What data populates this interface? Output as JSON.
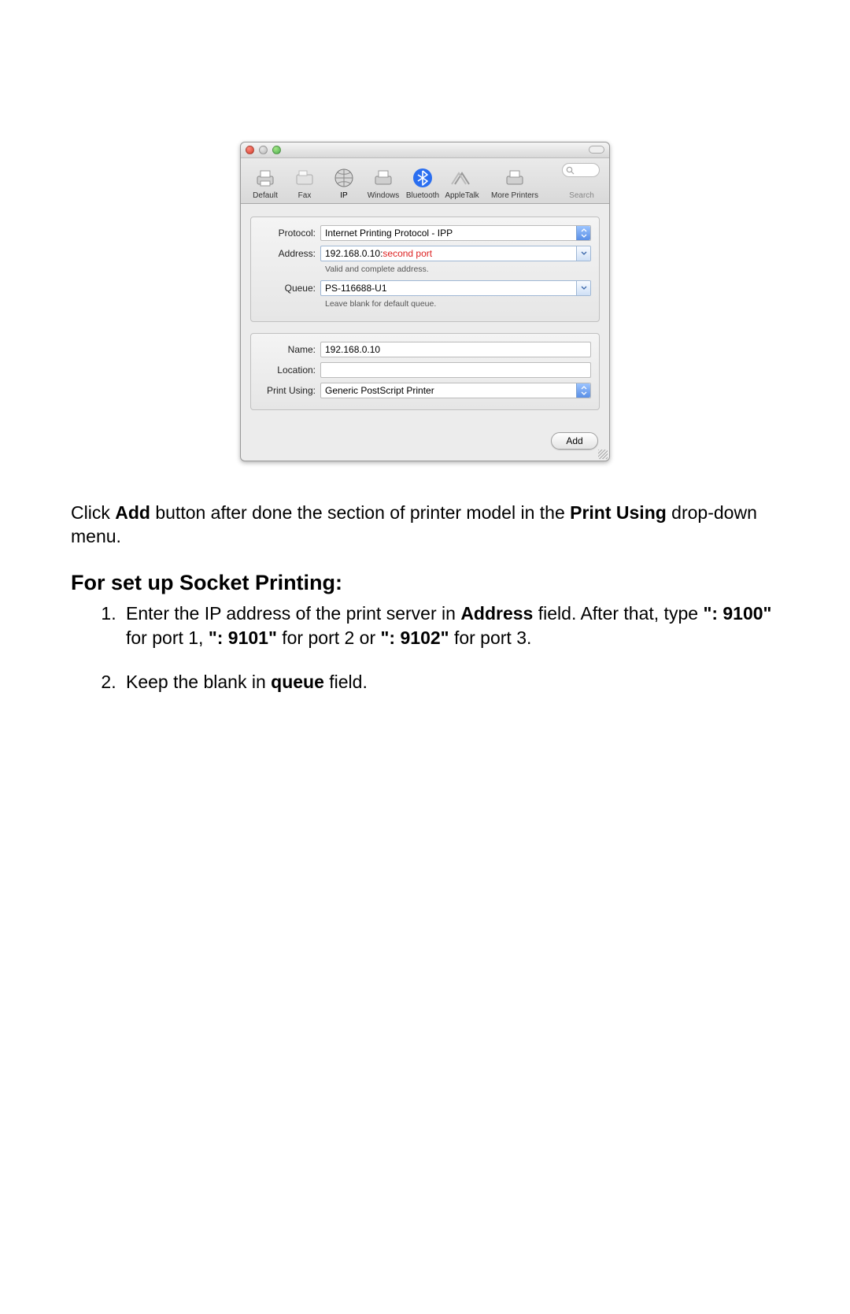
{
  "toolbar": {
    "items": [
      {
        "label": "Default"
      },
      {
        "label": "Fax"
      },
      {
        "label": "IP"
      },
      {
        "label": "Windows"
      },
      {
        "label": "Bluetooth"
      },
      {
        "label": "AppleTalk"
      },
      {
        "label": "More Printers"
      }
    ],
    "search_label": "Search"
  },
  "form": {
    "protocol": {
      "label": "Protocol:",
      "value": "Internet Printing Protocol - IPP"
    },
    "address": {
      "label": "Address:",
      "prefix": "192.168.0.10:",
      "suffix": " second port",
      "hint": "Valid and complete address."
    },
    "queue": {
      "label": "Queue:",
      "value": "PS-116688-U1",
      "hint": "Leave blank for default queue."
    },
    "name": {
      "label": "Name:",
      "value": "192.168.0.10"
    },
    "location": {
      "label": "Location:",
      "value": ""
    },
    "printusing": {
      "label": "Print Using:",
      "value": "Generic PostScript Printer"
    },
    "add_button": "Add"
  },
  "doc": {
    "para1_pre": "Click ",
    "para1_bold1": "Add",
    "para1_mid": " button after done the section of printer model in the ",
    "para1_bold2": "Print Using",
    "para1_post": " drop-down menu.",
    "heading": "For set up Socket Printing:",
    "li1_a": "Enter the IP address of the print server in ",
    "li1_b": "Address",
    "li1_c": " field. After that, type ",
    "li1_d": "\": 9100\"",
    "li1_e": " for port 1, ",
    "li1_f": "\": 9101\"",
    "li1_g": " for port 2 or ",
    "li1_h": "\": 9102\"",
    "li1_i": " for port 3.",
    "li2_a": "Keep the blank in ",
    "li2_b": "queue",
    "li2_c": " field."
  }
}
